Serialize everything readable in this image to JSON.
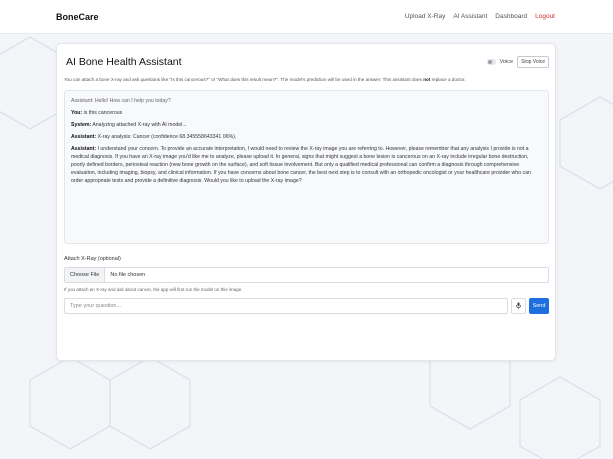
{
  "navbar": {
    "brand": "BoneCare",
    "links": [
      "Upload X-Ray",
      "AI Assistant",
      "Dashboard",
      "Logout"
    ]
  },
  "assistant": {
    "title": "AI Bone Health Assistant",
    "voice_label": "Voice",
    "voice_enabled": false,
    "stop_voice_label": "Stop Voice",
    "info_pre": "You can attach a bone X-ray and ask questions like \"Is this cancerous?\" or \"What does this result mean?\". The model's prediction will be used in the answer. This assistant does ",
    "info_bold": "not",
    "info_post": " replace a doctor."
  },
  "chat": {
    "greeting": "Assistant: Hello! How can I help you today?",
    "messages": [
      {
        "sender": "You:",
        "text": " is this cancerous"
      },
      {
        "sender": "System:",
        "text": " Analyzing attached X-ray with AI model..."
      },
      {
        "sender": "Assistant:",
        "text": " X-ray analysis: Cancer (confidence 68.345558643341 06%)."
      },
      {
        "sender": "Assistant:",
        "text": " I understand your concern. To provide an accurate interpretation, I would need to review the X-ray image you are referring to. However, please remember that any analysis I provide is not a medical diagnosis. If you have an X-ray image you'd like me to analyze, please upload it. In general, signs that might suggest a bone lesion is cancerous on an X-ray include irregular bone destruction, poorly defined borders, periosteal reaction (new bone growth on the surface), and soft tissue involvement. But only a qualified medical professional can confirm a diagnosis through comprehensive evaluation, including imaging, biopsy, and clinical information. If you have concerns about bone cancer, the best next step is to consult with an orthopedic oncologist or your healthcare provider who can order appropriate tests and provide a definitive diagnosis. Would you like to upload the X-ray image?"
      }
    ]
  },
  "attach": {
    "label": "Attach X-Ray (optional)",
    "choose_file_label": "Choose File",
    "file_status": "No file chosen",
    "hint": "If you attach an X-ray and ask about cancer, the app will first run the model on this image."
  },
  "question": {
    "placeholder": "Type your question...",
    "mic_icon": "microphone-icon",
    "send_label": "Send"
  },
  "colors": {
    "accent": "#1d6fe0",
    "logout": "#d0302f"
  }
}
